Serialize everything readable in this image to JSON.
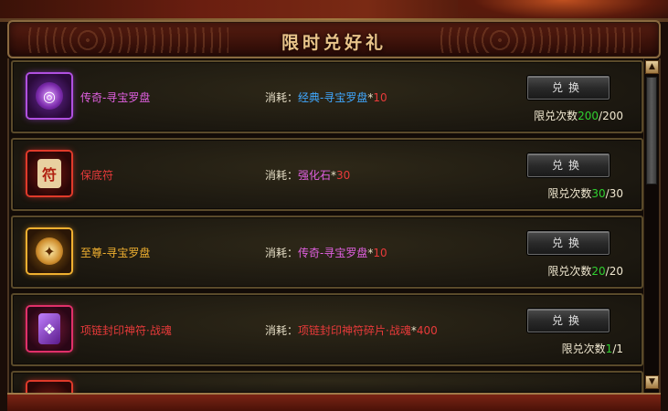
{
  "header": {
    "title": "限时兑好礼"
  },
  "colors": {
    "accent_gold": "#e8c48a",
    "used_count_green": "#30d030",
    "legend_purple": "#e060e0",
    "rare_red": "#e83a3a",
    "epic_orange": "#f0b030",
    "blue": "#40a8ff"
  },
  "items": [
    {
      "icon": "purple-compass-icon",
      "name": "传奇-寻宝罗盘",
      "cost_label": "消耗：",
      "cost_item": "经典-寻宝罗盘",
      "cost_star": "*",
      "cost_qty": "10",
      "button": "兑换",
      "limit_label": "限兑次数",
      "limit_used": "200",
      "limit_sep": "/",
      "limit_total": "200"
    },
    {
      "icon": "red-talisman-icon",
      "name": "保底符",
      "cost_label": "消耗：",
      "cost_item": "强化石",
      "cost_star": "*",
      "cost_qty": "30",
      "button": "兑换",
      "limit_label": "限兑次数",
      "limit_used": "30",
      "limit_sep": "/",
      "limit_total": "30"
    },
    {
      "icon": "gold-compass-icon",
      "name": "至尊-寻宝罗盘",
      "cost_label": "消耗：",
      "cost_item": "传奇-寻宝罗盘",
      "cost_star": "*",
      "cost_qty": "10",
      "button": "兑换",
      "limit_label": "限兑次数",
      "limit_used": "20",
      "limit_sep": "/",
      "limit_total": "20"
    },
    {
      "icon": "pink-seal-scroll-icon",
      "name": "项链封印神符·战魂",
      "cost_label": "消耗：",
      "cost_item": "项链封印神符碎片·战魂",
      "cost_star": "*",
      "cost_qty": "400",
      "button": "兑换",
      "limit_label": "限兑次数",
      "limit_used": "1",
      "limit_sep": "/",
      "limit_total": "1"
    }
  ],
  "scrollbar": {
    "up": "▲",
    "down": "▼"
  }
}
